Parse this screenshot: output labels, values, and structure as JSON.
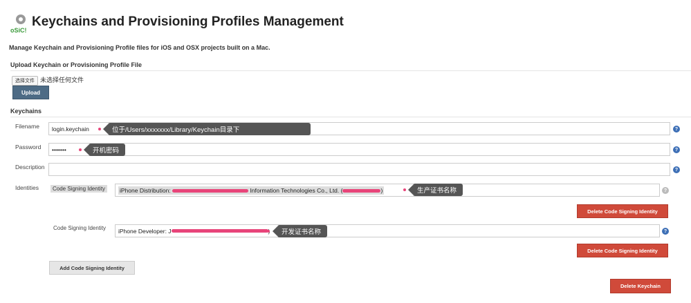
{
  "header": {
    "title": "Keychains and Provisioning Profiles Management",
    "logo_text": "SiC!",
    "description": "Manage Keychain and Provisioning Profile files for iOS and OSX projects built on a Mac."
  },
  "upload": {
    "section": "Upload Keychain or Provisioning Profile File",
    "choose_file": "选择文件",
    "no_file": "未选择任何文件",
    "upload_label": "Upload"
  },
  "keychains": {
    "section": "Keychains",
    "filename_label": "Filename",
    "filename_value": "login.keychain",
    "filename_note": "位于/Users/xxxxxxx/Library/Keychain目录下",
    "password_label": "Password",
    "password_value": "•••••••",
    "password_note": "开机密码",
    "description_label": "Description",
    "description_value": "",
    "identities_label": "Identities",
    "identities": [
      {
        "label": "Code Signing Identity",
        "prefix": "iPhone Distribution: ",
        "middle": " Information Technologies Co., Ltd. (",
        "suffix": ")",
        "note": "生产证书名称",
        "delete_label": "Delete Code Signing Identity"
      },
      {
        "label": "Code Signing Identity",
        "prefix": "iPhone Developer: J",
        "middle": "",
        "suffix": ")",
        "note": "开发证书名称",
        "delete_label": "Delete Code Signing Identity"
      }
    ],
    "add_identity_label": "Add Code Signing Identity",
    "delete_keychain_label": "Delete Keychain",
    "help": "?"
  }
}
